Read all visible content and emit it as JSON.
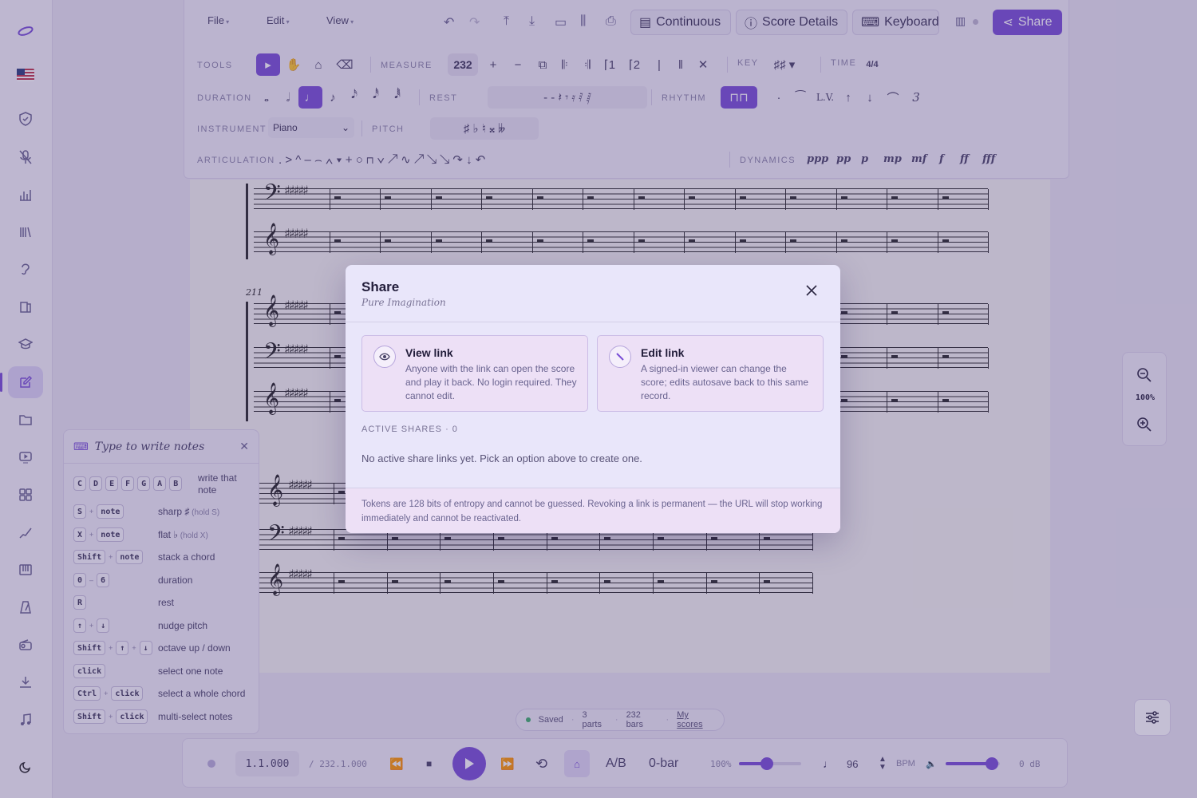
{
  "toolbar": {
    "menus": [
      "File",
      "Edit",
      "View"
    ],
    "continuous_label": "Continuous",
    "score_details_label": "Score Details",
    "keyboard_label": "Keyboard",
    "share_label": "Share",
    "tools_label": "TOOLS",
    "measure_label": "MEASURE",
    "measure_value": "232",
    "key_label": "KEY",
    "time_label": "TIME",
    "time_signature": "4/4",
    "duration_label": "DURATION",
    "rest_label": "REST",
    "rhythm_label": "RHYTHM",
    "rhythm_buttons": [
      "·",
      "⁀",
      "L.V.",
      "↑",
      "↓",
      "⌒",
      "3"
    ],
    "instrument_label": "INSTRUMENT",
    "instrument_value": "Piano",
    "pitch_label": "PITCH",
    "articulation_label": "ARTICULATION",
    "dynamics_label": "DYNAMICS",
    "dynamics": [
      "ppp",
      "pp",
      "p",
      "mp",
      "mf",
      "f",
      "ff",
      "fff"
    ]
  },
  "score": {
    "measure_number": "211"
  },
  "zoom": {
    "level": "100%"
  },
  "status": {
    "saved": "Saved",
    "parts": "3 parts",
    "bars": "232 bars",
    "link": "My scores"
  },
  "transport": {
    "position": "1.1.000",
    "total": "/ 232.1.000",
    "ab_label": "A/B",
    "count_in": "0-bar",
    "speed": "100%",
    "speed_fraction": 0.45,
    "tempo": "96",
    "bpm_label": "BPM",
    "volume": "0 dB",
    "volume_fraction": 0.85
  },
  "helper": {
    "title": "Type to write notes",
    "note_keys": [
      "C",
      "D",
      "E",
      "F",
      "G",
      "A",
      "B"
    ],
    "rows": [
      {
        "keys": [
          "C",
          "D",
          "E",
          "F",
          "G",
          "A",
          "B"
        ],
        "desc": "write that note",
        "hint": ""
      },
      {
        "keys": [
          "S",
          "note"
        ],
        "desc": "sharp ♯",
        "hint": "(hold S)"
      },
      {
        "keys": [
          "X",
          "note"
        ],
        "desc": "flat ♭",
        "hint": "(hold X)"
      },
      {
        "keys": [
          "Shift",
          "note"
        ],
        "desc": "stack a chord",
        "hint": ""
      },
      {
        "keys": [
          "0",
          "6"
        ],
        "desc": "duration",
        "hint": ""
      },
      {
        "keys": [
          "R"
        ],
        "desc": "rest",
        "hint": ""
      },
      {
        "keys": [
          "↑",
          "↓"
        ],
        "desc": "nudge pitch",
        "hint": ""
      },
      {
        "keys": [
          "Shift",
          "↑",
          "↓"
        ],
        "desc": "octave up / down",
        "hint": ""
      },
      {
        "keys": [
          "click"
        ],
        "desc": "select one note",
        "hint": ""
      },
      {
        "keys": [
          "Ctrl",
          "click"
        ],
        "desc": "select a whole chord",
        "hint": ""
      },
      {
        "keys": [
          "Shift",
          "click"
        ],
        "desc": "multi-select notes",
        "hint": ""
      }
    ]
  },
  "modal": {
    "title": "Share",
    "subtitle": "Pure Imagination",
    "view_title": "View link",
    "view_desc": "Anyone with the link can open the score and play it back. No login required. They cannot edit.",
    "edit_title": "Edit link",
    "edit_desc": "A signed-in viewer can change the score; edits autosave back to this same record.",
    "active_label": "ACTIVE SHARES · 0",
    "empty_msg": "No active share links yet. Pick an option above to create one.",
    "footer": "Tokens are 128 bits of entropy and cannot be guessed. Revoking a link is permanent — the URL will stop working immediately and cannot be reactivated."
  },
  "colors": {
    "accent": "#7a4fd6",
    "modal_bg": "#e9e6fa",
    "card_bg": "#ede0f6"
  },
  "icons": {
    "rail": [
      "logo-icon",
      "flag-icon",
      "shield-icon",
      "mic-off-icon",
      "chart-icon",
      "library-icon",
      "ear-icon",
      "book-icon",
      "graduation-icon",
      "compose-icon",
      "folder-music-icon",
      "screen-play-icon",
      "grid-icon",
      "staircase-icon",
      "piano-icon",
      "metronome-icon",
      "radio-icon",
      "download-icon",
      "music-note-icon",
      "moon-icon"
    ]
  }
}
